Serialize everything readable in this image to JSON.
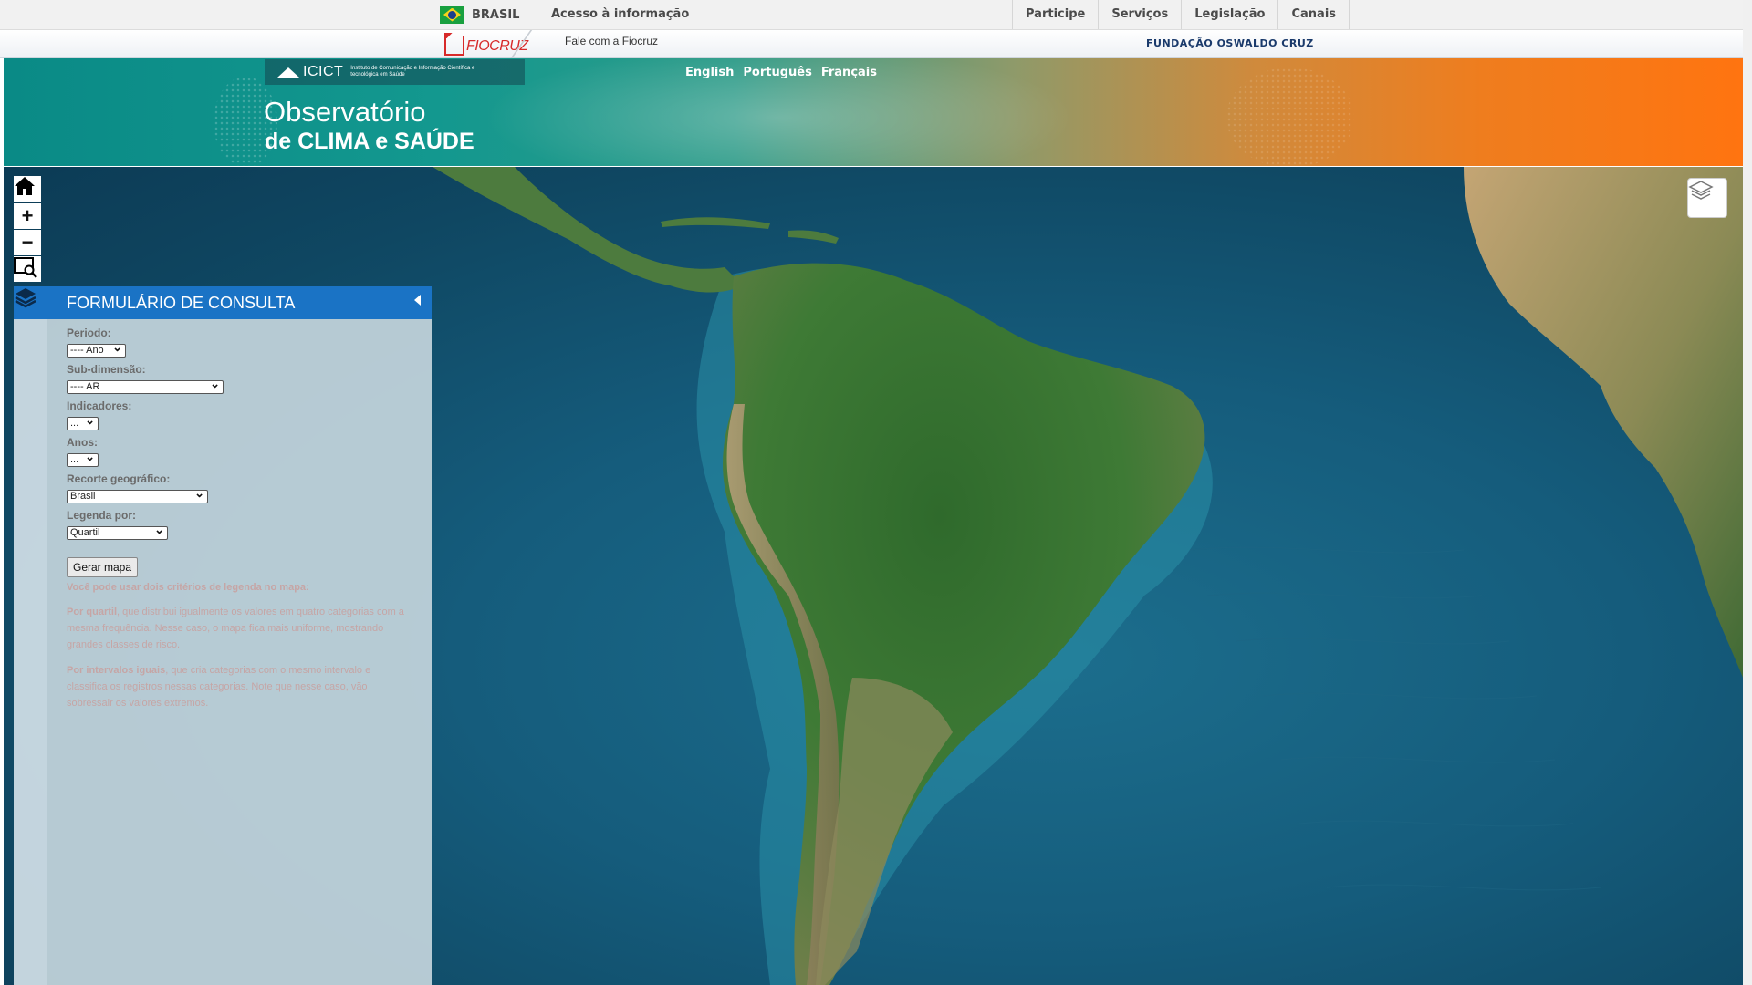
{
  "gov_bar": {
    "country": "BRASIL",
    "access_link": "Acesso à informação",
    "menu": [
      "Participe",
      "Serviços",
      "Legislação",
      "Canais"
    ]
  },
  "fiocruz_bar": {
    "logo_text": "FIOCRUZ",
    "contact_link": "Fale com a Fiocruz",
    "foundation": "FUNDAÇÃO OSWALDO CRUZ"
  },
  "header": {
    "icict_abbr": "ICICT",
    "icict_name": "Instituto de Comunicação e Informação Científica e tecnológica em Saúde",
    "languages": [
      "English",
      "Português",
      "Français"
    ],
    "title_line1": "Observatório",
    "title_line2": "de CLIMA e SAÚDE"
  },
  "map": {
    "icons": [
      "home-icon",
      "zoom-in-icon",
      "zoom-out-icon",
      "zoom-box-icon",
      "layers-icon"
    ],
    "zoom_in": "+",
    "zoom_out": "−"
  },
  "query_form": {
    "title": "FORMULÁRIO DE CONSULTA",
    "periodo_label": "Periodo:",
    "periodo_value": "---- Ano",
    "subdimensao_label": "Sub-dimensão:",
    "subdimensao_value": "---- AR",
    "indicadores_label": "Indicadores:",
    "indicadores_value": "...",
    "anos_label": "Anos:",
    "anos_value": "...",
    "recorte_label": "Recorte geográfico:",
    "recorte_value": "Brasil",
    "legenda_label": "Legenda por:",
    "legenda_value": "Quartil",
    "submit": "Gerar mapa",
    "help_intro": "Você pode usar dois critérios de legenda no mapa:",
    "help_quartil_term": "Por quartil",
    "help_quartil_text": ", que distribui igualmente os valores em quatro categorias com a mesma frequência. Nesse caso, o mapa fica mais uniforme, mostrando grandes classes de risco.",
    "help_intervalos_term": "Por intervalos iguais",
    "help_intervalos_text": ", que cria categorias com o mesmo intervalo e classifica os registros nessas categorias. Note que nesse caso, vão sobressair os valores extremos."
  },
  "colors": {
    "panel_header": "#1a73c5",
    "header_teal": "#0a8a86",
    "header_orange": "#ff7410"
  }
}
